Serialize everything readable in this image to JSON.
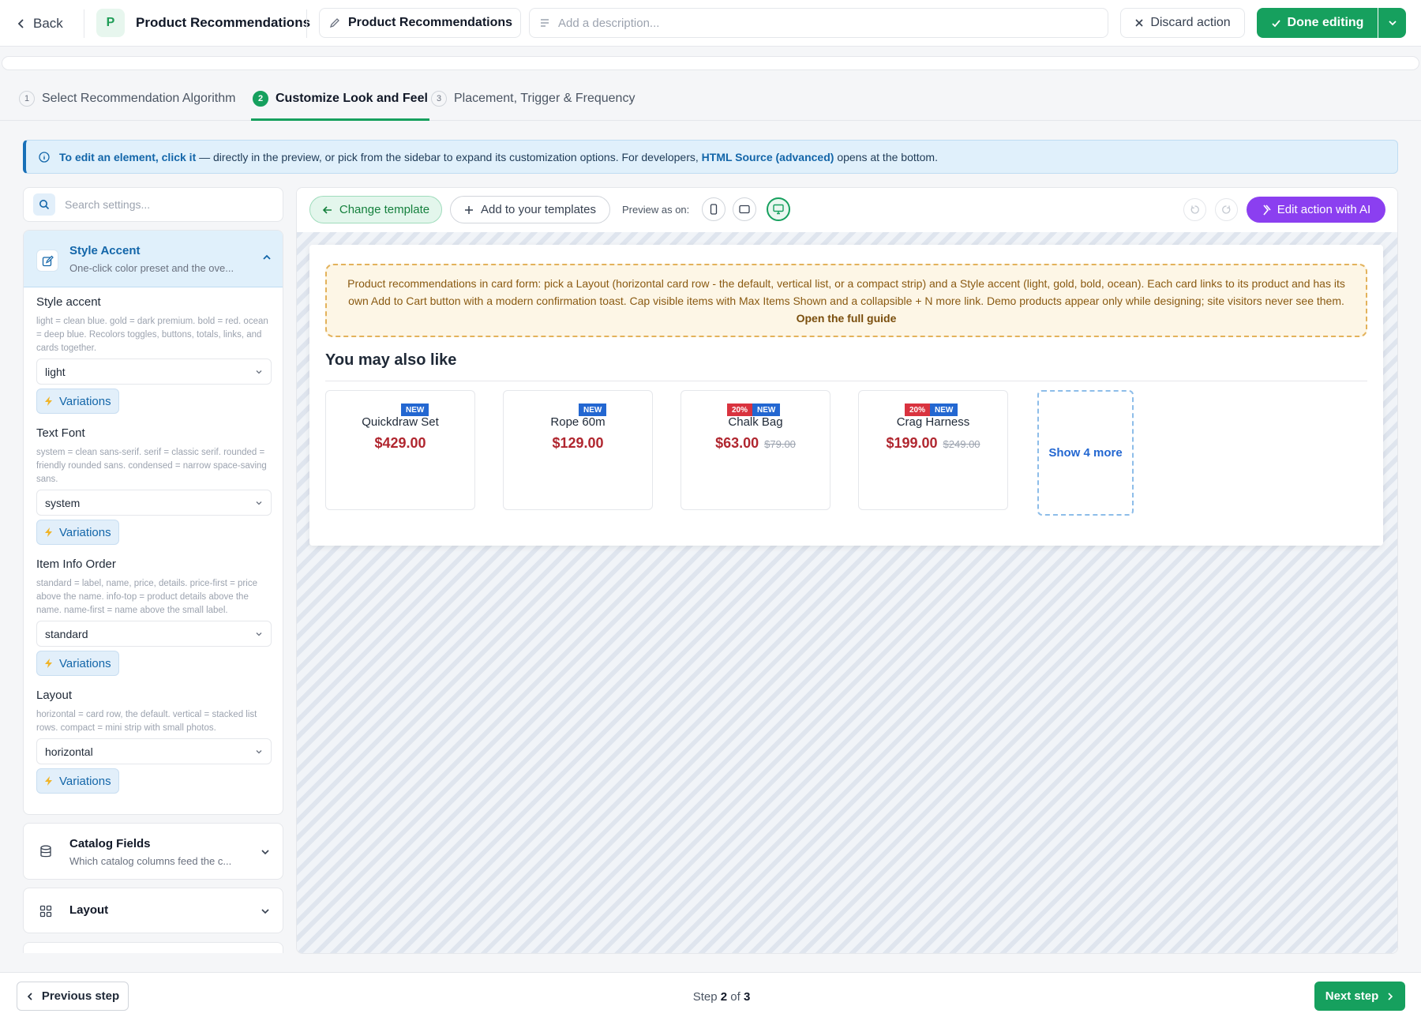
{
  "header": {
    "back_label": "Back",
    "app_avatar_letter": "P",
    "app_title": "Product Recommendations",
    "action_name": "Product Recommendations",
    "description_placeholder": "Add a description...",
    "discard_label": "Discard action",
    "done_label": "Done editing"
  },
  "tabs": [
    {
      "num": "1",
      "label": "Select Recommendation Algorithm",
      "active": false
    },
    {
      "num": "2",
      "label": "Customize Look and Feel",
      "active": true
    },
    {
      "num": "3",
      "label": "Placement, Trigger & Frequency",
      "active": false
    }
  ],
  "info_banner": {
    "lead": "To edit an element, click it",
    "middle": " — directly in the preview, or pick from the sidebar to expand its customization options. For developers, ",
    "link": "HTML Source (advanced)",
    "tail": " opens at the bottom."
  },
  "sidebar": {
    "search_placeholder": "Search settings...",
    "open_section": {
      "title": "Style Accent",
      "subtitle": "One-click color preset and the ove...",
      "fields": [
        {
          "label": "Style accent",
          "help": "light = clean blue. gold = dark premium. bold = red. ocean = deep blue. Recolors toggles, buttons, totals, links, and cards together.",
          "value": "light",
          "variations_label": "Variations"
        },
        {
          "label": "Text Font",
          "help": "system = clean sans-serif. serif = classic serif. rounded = friendly rounded sans. condensed = narrow space-saving sans.",
          "value": "system",
          "variations_label": "Variations"
        },
        {
          "label": "Item Info Order",
          "help": "standard = label, name, price, details. price-first = price above the name. info-top = product details above the name. name-first = name above the small label.",
          "value": "standard",
          "variations_label": "Variations"
        },
        {
          "label": "Layout",
          "help": "horizontal = card row, the default. vertical = stacked list rows. compact = mini strip with small photos.",
          "value": "horizontal",
          "variations_label": "Variations"
        }
      ]
    },
    "catalog_fields": {
      "title": "Catalog Fields",
      "subtitle": "Which catalog columns feed the c..."
    },
    "layout_section": {
      "title": "Layout"
    }
  },
  "preview": {
    "change_template_label": "Change template",
    "add_template_label": "Add to your templates",
    "preview_as_label": "Preview as on:",
    "edit_ai_label": "Edit action with AI",
    "notice_text": "Product recommendations in card form: pick a Layout (horizontal card row - the default, vertical list, or a compact strip) and a Style accent (light, gold, bold, ocean). Each card links to its product and has its own Add to Cart button with a modern confirmation toast. Cap visible items with Max Items Shown and a collapsible + N more link. Demo products appear only while designing; site visitors never see them. ",
    "notice_link": "Open the full guide",
    "heading": "You may also like",
    "products": [
      {
        "name": "Quickdraw Set",
        "price": "$429.00",
        "old_price": "",
        "sale": "",
        "new": "NEW"
      },
      {
        "name": "Rope 60m",
        "price": "$129.00",
        "old_price": "",
        "sale": "",
        "new": "NEW"
      },
      {
        "name": "Chalk Bag",
        "price": "$63.00",
        "old_price": "$79.00",
        "sale": "20%",
        "new": "NEW"
      },
      {
        "name": "Crag Harness",
        "price": "$199.00",
        "old_price": "$249.00",
        "sale": "20%",
        "new": "NEW"
      }
    ],
    "show_more_label": "Show 4 more"
  },
  "footer": {
    "prev_label": "Previous step",
    "step_word": "Step",
    "step_current": "2",
    "step_of": "of",
    "step_total": "3",
    "next_label": "Next step"
  },
  "colors": {
    "primary_green": "#16a05e",
    "info_blue": "#1366a9",
    "ai_purple": "#8b3ff0",
    "price_red": "#b0262f",
    "badge_new": "#2367d1",
    "badge_sale": "#d9333f"
  }
}
